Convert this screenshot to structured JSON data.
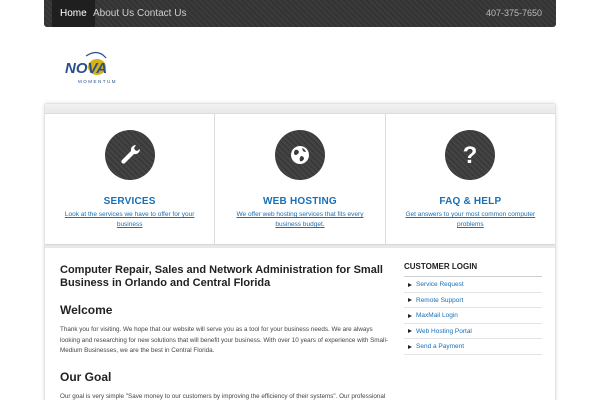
{
  "nav": {
    "items": [
      {
        "label": "Home",
        "active": true
      },
      {
        "label": "About Us",
        "active": false
      },
      {
        "label": "Contact Us",
        "active": false
      }
    ],
    "phone": "407-375-7650"
  },
  "logo": {
    "text": "NOVA",
    "tagline": "MOMENTUM"
  },
  "features": [
    {
      "icon": "wrench-icon",
      "title": "SERVICES",
      "link": "Look at the services we have to offer for your business"
    },
    {
      "icon": "globe-icon",
      "title": "WEB HOSTING",
      "link": "We offer web hosting services that fits every business budget."
    },
    {
      "icon": "question-icon",
      "title": "FAQ & HELP",
      "link": "Get answers to your most common computer problems"
    }
  ],
  "main": {
    "heading": "Computer Repair, Sales and Network Administration for Small Business in  Orlando and Central Florida",
    "welcome_title": "Welcome",
    "welcome_text": "Thank you for visiting. We hope that our website will serve you as a tool for your business needs. We are always looking and researching for new solutions that will benefit your business. With over 10 years of experience with Small-Medium Businesses, we are the best in Central Florida.",
    "goal_title": "Our Goal",
    "goal_text": "Our goal is very simple \"Save money to our customers by improving the efficiency of their systems\". Our professional staff"
  },
  "sidebar": {
    "title": "CUSTOMER LOGIN",
    "items": [
      "Service Request",
      "Remote Support",
      "MaxMail Login",
      "Web Hosting Portal",
      "Send a Payment"
    ]
  },
  "colors": {
    "accent": "#1a6fb5",
    "nav_bg": "#353535",
    "icon_bg": "#3a3a3a"
  }
}
